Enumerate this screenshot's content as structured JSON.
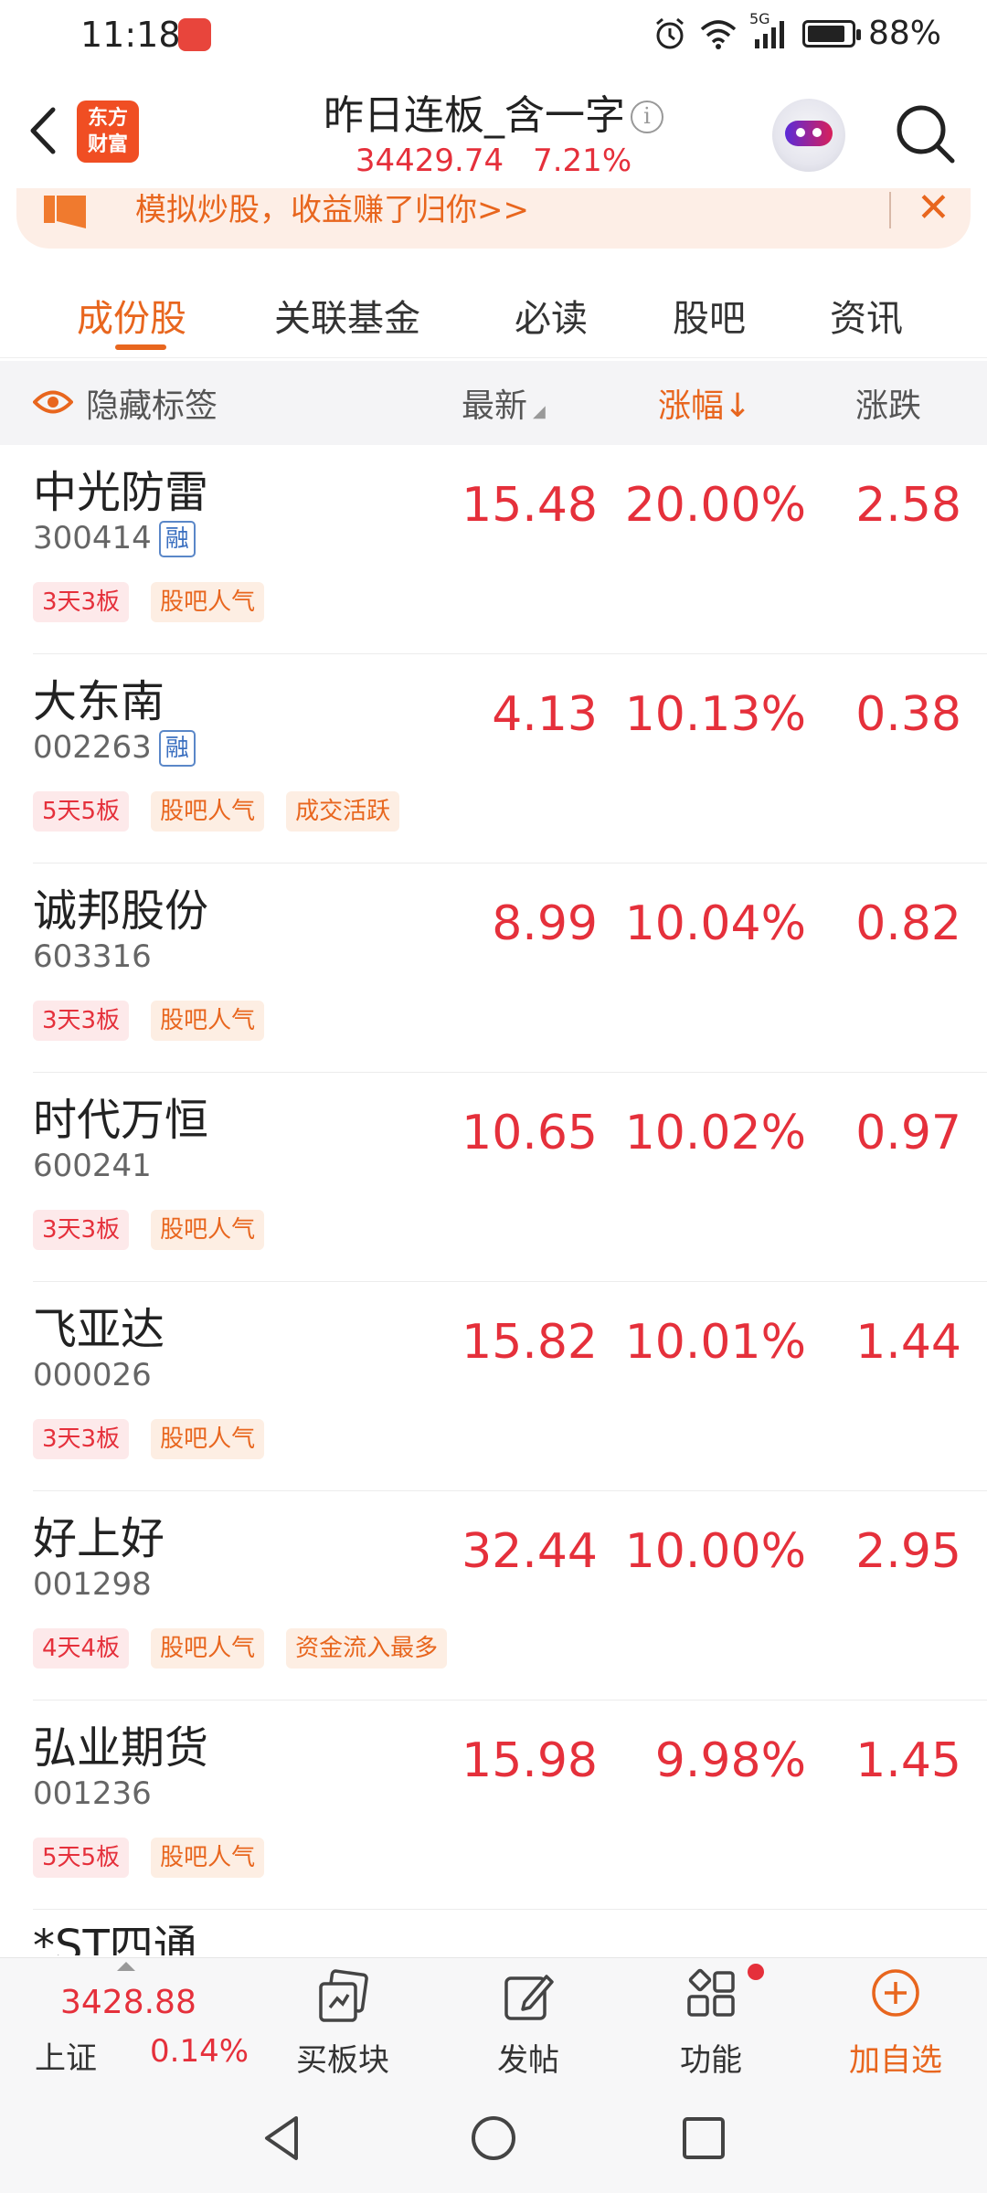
{
  "status": {
    "time": "11:18",
    "network": "5G",
    "battery": "88%",
    "battery_level": 0.88
  },
  "header": {
    "title": "昨日连板_含一字",
    "info_glyph": "i",
    "index_value": "34429.74",
    "index_pct": "7.21%",
    "logo_line1": "东方",
    "logo_line2": "财富"
  },
  "banner": {
    "text": "模拟炒股，收益赚了归你>>",
    "close": "✕"
  },
  "tabs": [
    "成份股",
    "关联基金",
    "必读",
    "股吧",
    "资讯"
  ],
  "table_header": {
    "hide_label": "隐藏标签",
    "latest": "最新",
    "pct": "涨幅",
    "pct_arrow": "↓",
    "chg": "涨跌"
  },
  "stocks": [
    {
      "name": "中光防雷",
      "code": "300414",
      "rong": "融",
      "latest": "15.48",
      "pct": "20.00%",
      "chg": "2.58",
      "tags": [
        {
          "text": "3天3板",
          "kind": "red"
        },
        {
          "text": "股吧人气",
          "kind": "orange"
        }
      ]
    },
    {
      "name": "大东南",
      "code": "002263",
      "rong": "融",
      "latest": "4.13",
      "pct": "10.13%",
      "chg": "0.38",
      "tags": [
        {
          "text": "5天5板",
          "kind": "red"
        },
        {
          "text": "股吧人气",
          "kind": "orange"
        },
        {
          "text": "成交活跃",
          "kind": "orange"
        }
      ]
    },
    {
      "name": "诚邦股份",
      "code": "603316",
      "rong": "",
      "latest": "8.99",
      "pct": "10.04%",
      "chg": "0.82",
      "tags": [
        {
          "text": "3天3板",
          "kind": "red"
        },
        {
          "text": "股吧人气",
          "kind": "orange"
        }
      ]
    },
    {
      "name": "时代万恒",
      "code": "600241",
      "rong": "",
      "latest": "10.65",
      "pct": "10.02%",
      "chg": "0.97",
      "tags": [
        {
          "text": "3天3板",
          "kind": "red"
        },
        {
          "text": "股吧人气",
          "kind": "orange"
        }
      ]
    },
    {
      "name": "飞亚达",
      "code": "000026",
      "rong": "",
      "latest": "15.82",
      "pct": "10.01%",
      "chg": "1.44",
      "tags": [
        {
          "text": "3天3板",
          "kind": "red"
        },
        {
          "text": "股吧人气",
          "kind": "orange"
        }
      ]
    },
    {
      "name": "好上好",
      "code": "001298",
      "rong": "",
      "latest": "32.44",
      "pct": "10.00%",
      "chg": "2.95",
      "tags": [
        {
          "text": "4天4板",
          "kind": "red"
        },
        {
          "text": "股吧人气",
          "kind": "orange"
        },
        {
          "text": "资金流入最多",
          "kind": "orange"
        }
      ]
    },
    {
      "name": "弘业期货",
      "code": "001236",
      "rong": "",
      "latest": "15.98",
      "pct": "9.98%",
      "chg": "1.45",
      "tags": [
        {
          "text": "5天5板",
          "kind": "red"
        },
        {
          "text": "股吧人气",
          "kind": "orange"
        }
      ]
    }
  ],
  "partial_row": "*ST四通",
  "toolbar": {
    "index_value": "3428.88",
    "index_name": "上证",
    "index_pct": "0.14%",
    "buttons": [
      "买板块",
      "发帖",
      "功能",
      "加自选"
    ]
  },
  "colors": {
    "up_red": "#e5303b",
    "accent_orange": "#e8661e",
    "rong_blue": "#3a6fc0"
  }
}
